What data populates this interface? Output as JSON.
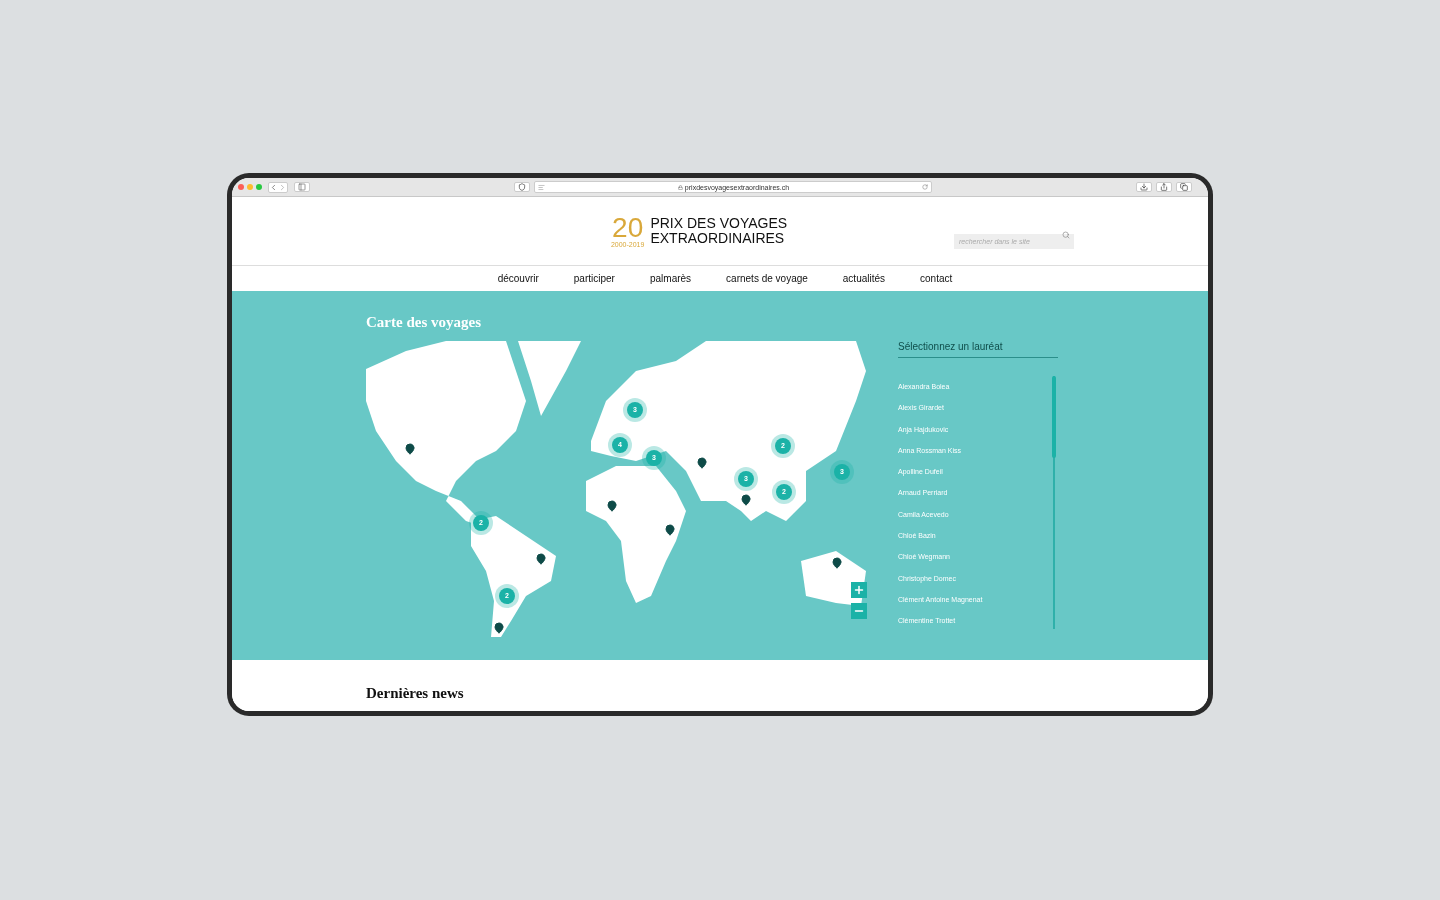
{
  "browser": {
    "url": "prixdesvoyagesextraordinaires.ch"
  },
  "logo": {
    "number": "20",
    "years": "2000-2019",
    "line1": "PRIX DES VOYAGES",
    "line2": "EXTRAORDINAIRES"
  },
  "search": {
    "placeholder": "rechercher dans le site"
  },
  "nav": [
    "découvrir",
    "participer",
    "palmarès",
    "carnets de voyage",
    "actualités",
    "contact"
  ],
  "map_section": {
    "title": "Carte des voyages",
    "clusters": [
      {
        "count": "3"
      },
      {
        "count": "4"
      },
      {
        "count": "3"
      },
      {
        "count": "2"
      },
      {
        "count": "3"
      },
      {
        "count": "2"
      },
      {
        "count": "3"
      },
      {
        "count": "2"
      },
      {
        "count": "2"
      }
    ]
  },
  "laureates": {
    "heading": "Sélectionnez un lauréat",
    "items": [
      "Alexandra Bolea",
      "Alexis Girardet",
      "Anja Hajdukovic",
      "Anna Rossman Kiss",
      "Apolline Dufeil",
      "Arnaud Perriard",
      "Camila Acevedo",
      "Chloé Bazin",
      "Chloé Wegmann",
      "Christophe Domec",
      "Clément Antoine Magnenat",
      "Clémentine Trottet"
    ]
  },
  "news": {
    "heading": "Dernières news"
  }
}
